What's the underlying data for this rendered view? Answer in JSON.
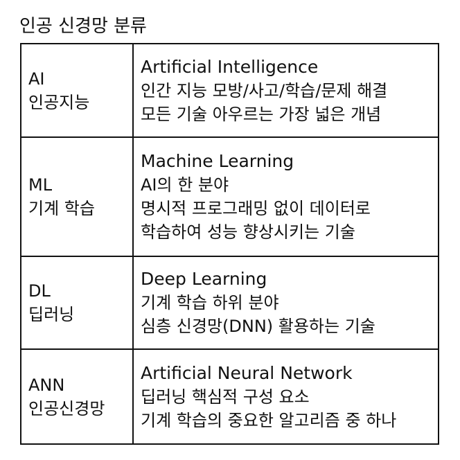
{
  "title": "인공 신경망 분류",
  "rows": [
    {
      "abbr": "AI",
      "korean": "인공지능",
      "english": "Artificial Intelligence",
      "lines": [
        "인간 지능 모방/사고/학습/문제 해결",
        "모든 기술 아우르는 가장 넓은 개념"
      ]
    },
    {
      "abbr": "ML",
      "korean": "기계 학습",
      "english": "Machine Learning",
      "lines": [
        "AI의 한 분야",
        "명시적 프로그래밍 없이 데이터로",
        "학습하여 성능 향상시키는 기술"
      ]
    },
    {
      "abbr": "DL",
      "korean": "딥러닝",
      "english": "Deep Learning",
      "lines": [
        "기계 학습 하위 분야",
        "심층 신경망(DNN) 활용하는 기술"
      ]
    },
    {
      "abbr": "ANN",
      "korean": "인공신경망",
      "english": "Artificial Neural Network",
      "lines": [
        "딥러닝 핵심적 구성 요소",
        "기계 학습의 중요한 알고리즘 중 하나"
      ]
    }
  ]
}
